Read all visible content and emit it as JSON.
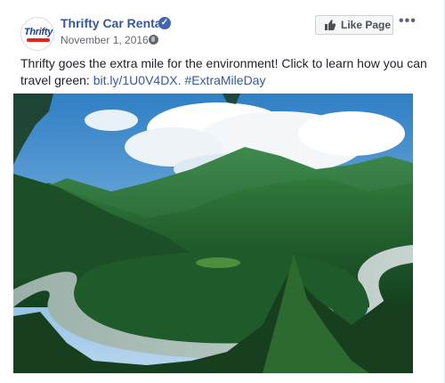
{
  "post": {
    "page_name": "Thrifty Car Rental",
    "avatar_text": "Thrifty",
    "date": "November 1, 2016",
    "meta_separator": "·",
    "like_page_label": "Like Page",
    "more_label": "•••",
    "text_line_1": "Thrifty goes the extra mile for the environment! Click to learn how you can",
    "text_line_2_prefix": "travel green: ",
    "short_link": "bit.ly/1U0V4DX",
    "link_separator": ". ",
    "hashtag": "#ExtraMileDay"
  },
  "icons": {
    "verified": "verified-check-icon",
    "privacy": "globe-icon",
    "like": "thumbs-up-icon",
    "more": "more-options-icon"
  },
  "colors": {
    "link": "#365899",
    "verified_badge": "#4267b2",
    "brand_red": "#e1251b",
    "brand_blue": "#1b3f8f"
  }
}
